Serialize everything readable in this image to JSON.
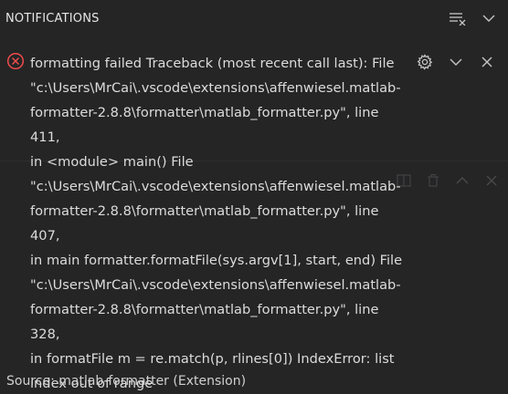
{
  "header": {
    "title": "NOTIFICATIONS"
  },
  "notification": {
    "message": "formatting failed Traceback (most recent call last): File\n\"c:\\Users\\MrCai\\.vscode\\extensions\\affenwiesel.matlab-\nformatter-2.8.8\\formatter\\matlab_formatter.py\", line 411,\nin <module> main() File\n\"c:\\Users\\MrCai\\.vscode\\extensions\\affenwiesel.matlab-\nformatter-2.8.8\\formatter\\matlab_formatter.py\", line 407,\nin main formatter.formatFile(sys.argv[1], start, end) File\n\"c:\\Users\\MrCai\\.vscode\\extensions\\affenwiesel.matlab-\nformatter-2.8.8\\formatter\\matlab_formatter.py\", line 328,\nin formatFile m = re.match(p, rlines[0]) IndexError: list\nindex out of range",
    "source": "Source: matlab-formatter (Extension)",
    "severity": "error"
  },
  "icons": {
    "clear_all": "clear-all-icon",
    "collapse": "chevron-down-icon",
    "error": "error-icon",
    "settings": "gear-icon",
    "expand": "chevron-down-icon",
    "close": "close-icon"
  },
  "colors": {
    "error": "#f14c4c",
    "background": "#252526",
    "text": "#dcdcdc"
  }
}
